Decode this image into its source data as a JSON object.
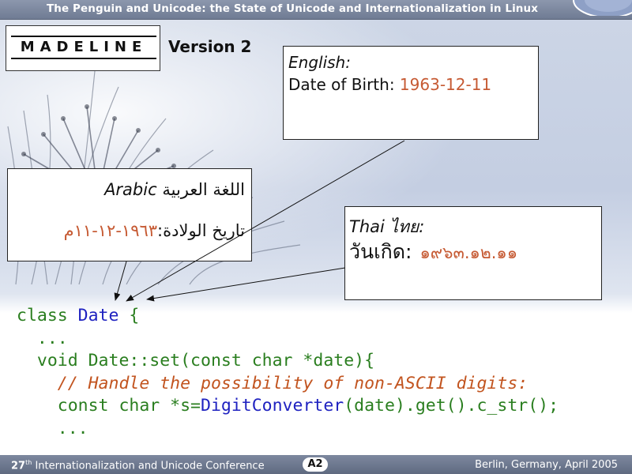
{
  "header": {
    "title": "The Penguin and Unicode: the State of Unicode and Internationalization in Linux"
  },
  "logo": {
    "text": "MADELINE",
    "version": "Version 2"
  },
  "english": {
    "title": "English:",
    "label": "Date of Birth: ",
    "value": "1963-12-11"
  },
  "arabic": {
    "title_latin": "Arabic",
    "title_native": "اللغة العربية",
    "label": "تاريخ الولادة:",
    "value": "١٩٦٣-١٢-١١م"
  },
  "thai": {
    "title_latin": "Thai",
    "title_native": "ไทย:",
    "label": "วันเกิด:",
    "value": "๑๙๖๓.๑๒.๑๑"
  },
  "code": {
    "l1_kw": "class ",
    "l1_name": "Date",
    "l1_rest": " {",
    "l2": "  ...",
    "l3": "  void Date::set(const char *date){",
    "l4": "    // Handle the possibility of non-ASCII digits:",
    "l5_a": "    const char *s=",
    "l5_b": "DigitConverter",
    "l5_c": "(date).get().c_str();",
    "l6": "    ..."
  },
  "footer": {
    "left_num": "27",
    "left_sup": "th",
    "left_text": " Internationalization and Unicode Conference",
    "badge": "A2",
    "right": "Berlin, Germany, April 2005"
  },
  "colors": {
    "accent_value": "#c65a33",
    "code_green": "#2a7e1f",
    "code_blue": "#1f22c0",
    "bar": "#6f7b93"
  }
}
